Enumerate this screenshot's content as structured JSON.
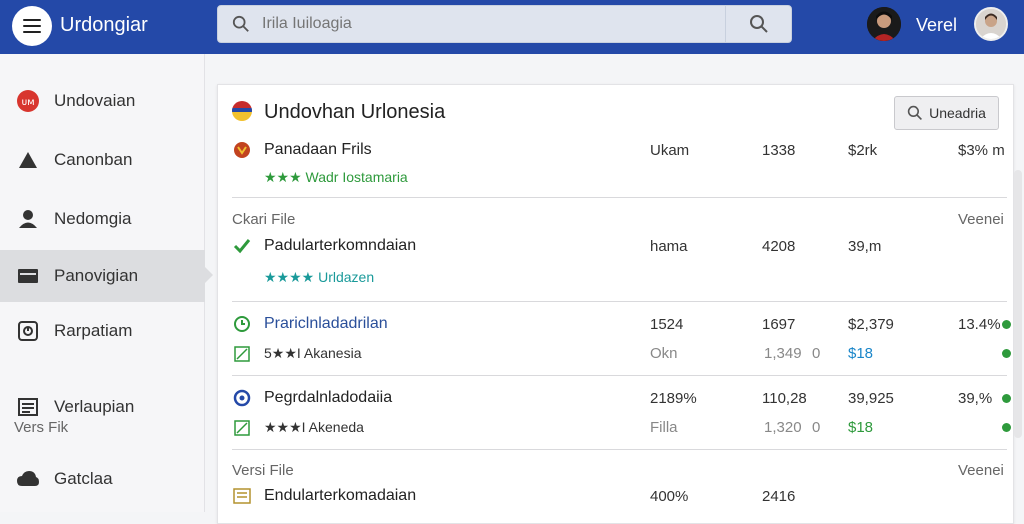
{
  "header": {
    "app_title": "Urdongiar",
    "search_placeholder": "Irila Iuiloagia",
    "user_name": "Verel"
  },
  "sidebar": {
    "items": [
      {
        "label": "Undovaian",
        "icon": "brand-logo-icon"
      },
      {
        "label": "Canonban",
        "icon": "person-icon"
      },
      {
        "label": "Nedomgia",
        "icon": "user-icon"
      },
      {
        "label": "Panovigian",
        "icon": "card-icon",
        "active": true
      },
      {
        "label": "Rarpatiam",
        "icon": "clock-icon"
      },
      {
        "label": "Verlaupian",
        "icon": "list-icon"
      },
      {
        "label": "Gatclaa",
        "icon": "cloud-icon"
      }
    ],
    "section_label": "Vers Fik"
  },
  "panel": {
    "title": "Undovhan Urlonesia",
    "button_label": "Uneadria",
    "rows": [
      {
        "name": "Panadaan Frils",
        "sub": "★★★ Wadr Iostamaria",
        "col1": "Ukam",
        "col2": "1338",
        "col3": "$2rk",
        "col4": "$3% m"
      },
      {
        "section_left": "Ckari File",
        "section_right": "Veenei",
        "name": "Padularterkomndaian",
        "sub": "★★★★ Urldazen",
        "col1": "hama",
        "col2": "4208",
        "col3": "39,m"
      },
      {
        "name": "Prariclnladadrilan",
        "sub": "5★★I Akanesia",
        "col1": "1524",
        "col2": "1697",
        "col3": "$2,379",
        "col4": "13.4%",
        "sub_col1": "Okn",
        "sub_col2": "1,349",
        "sub_col2b": "0",
        "sub_col3": "$18"
      },
      {
        "name": "Pegrdalnladodaiia",
        "sub": "★★★I Akeneda",
        "col1": "2189%",
        "col2": "110,28",
        "col3": "39,925",
        "col4": "39,%",
        "sub_col1": "Filla",
        "sub_col2": "1,320",
        "sub_col2b": "0",
        "sub_col3": "$18"
      },
      {
        "section_left": "Versi File",
        "section_right": "Veenei",
        "name": "Endularterkomadaian",
        "col1": "400%",
        "col2": "2416"
      }
    ]
  },
  "colors": {
    "topbar": "#2449a8",
    "accent_green": "#2e9a3c",
    "accent_teal": "#1a9a9a",
    "star_gold": "#b3922e"
  }
}
